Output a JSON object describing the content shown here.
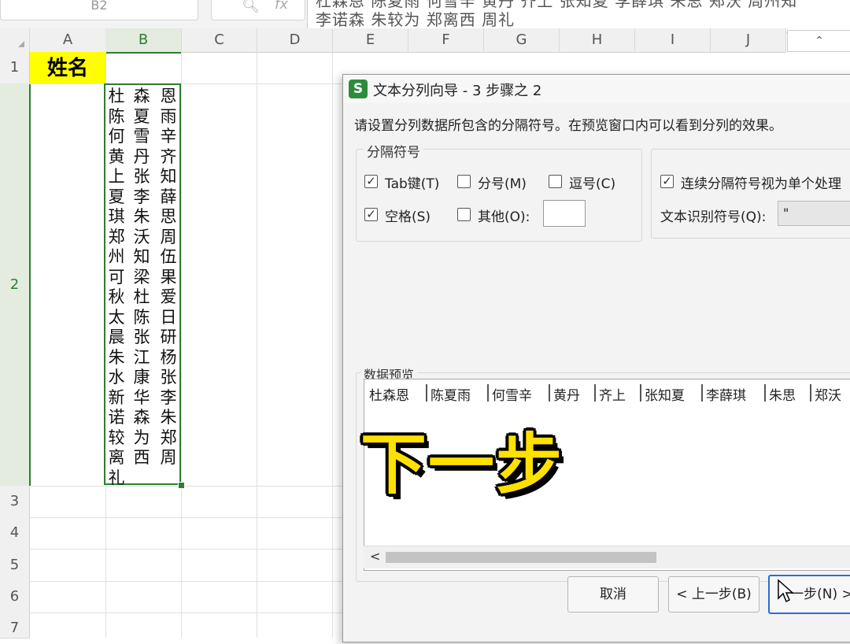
{
  "formula_bar": {
    "cell_ref": "B2",
    "fx_label": "fx",
    "content_line1": "杜森恩 陈夏雨 何雪辛 黄丹 齐上 张知夏 李薛琪 朱思 郑沃 周州知",
    "content_line2": "李诺森 朱较为 郑离西 周礼"
  },
  "columns": [
    "A",
    "B",
    "C",
    "D",
    "E",
    "F",
    "G",
    "H",
    "I",
    "J"
  ],
  "rows": [
    "1",
    "2",
    "3",
    "4",
    "5",
    "6",
    "7"
  ],
  "cells": {
    "a1": "姓名",
    "b2_columns": [
      [
        "杜",
        "陈",
        "何",
        "黄",
        "上",
        "夏",
        "琪",
        "郑",
        "州",
        "可",
        "秋",
        "太",
        "晨",
        "朱",
        "水",
        "新",
        "诺",
        "较",
        "离",
        "礼"
      ],
      [
        "森",
        "夏",
        "雪",
        "丹",
        "张",
        "李",
        "朱",
        "沃",
        "知",
        "梁",
        "杜",
        "陈",
        "张",
        "江",
        "康",
        "华",
        "森",
        "为",
        "西"
      ],
      [
        "恩",
        "雨",
        "辛",
        "齐",
        "知",
        "薛",
        "思",
        "周",
        "伍",
        "果",
        "爱",
        "日",
        "研",
        "杨",
        "张",
        "李",
        "朱",
        "郑",
        "周"
      ]
    ]
  },
  "dialog": {
    "app_icon": "S",
    "title": "文本分列向导 - 3 步骤之 2",
    "description": "请设置分列数据所包含的分隔符号。在预览窗口内可以看到分列的效果。",
    "delimiters_group": "分隔符号",
    "options": {
      "tab": {
        "label": "Tab键(T)",
        "checked": true
      },
      "semicolon": {
        "label": "分号(M)",
        "checked": false
      },
      "comma": {
        "label": "逗号(C)",
        "checked": false
      },
      "space": {
        "label": "空格(S)",
        "checked": true
      },
      "other": {
        "label": "其他(O):",
        "checked": false,
        "value": ""
      }
    },
    "consecutive": {
      "label": "连续分隔符号视为单个处理",
      "checked": true
    },
    "text_qualifier": {
      "label": "文本识别符号(Q):",
      "value": "\""
    },
    "preview_label": "数据预览",
    "preview_row": [
      "杜森恩",
      "陈夏雨",
      "何雪辛",
      "黄丹",
      "齐上",
      "张知夏",
      "李薛琪",
      "朱思",
      "郑沃"
    ],
    "scroll_left": "<",
    "buttons": {
      "cancel": "取消",
      "back": "< 上一步(B)",
      "next": "一步(N) >"
    }
  },
  "overlay_caption": "下一步",
  "colors": {
    "selection_green": "#2e7d32",
    "a1_fill": "#ffff00",
    "caption_yellow": "#ffe100"
  }
}
